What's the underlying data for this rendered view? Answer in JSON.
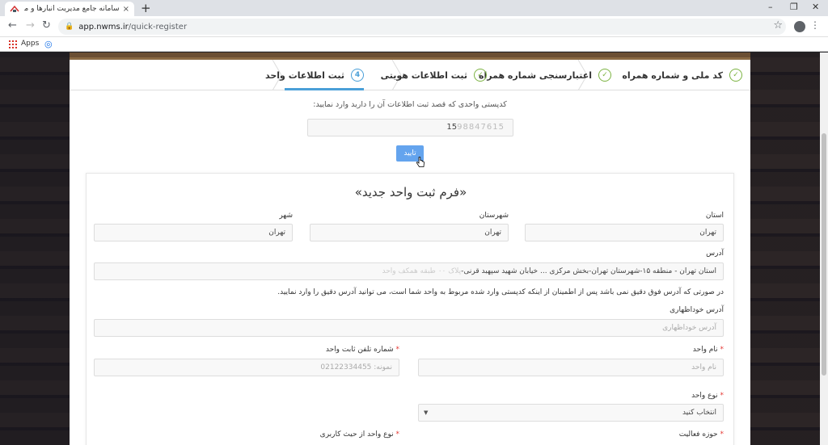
{
  "browser": {
    "tab_title": "سامانه جامع مدیریت انبارها و مراک",
    "tab_close": "×",
    "new_tab": "+",
    "url_domain": "app.nwms.ir",
    "url_path": "/quick-register",
    "bookmarks_apps": "Apps",
    "window_controls": [
      "–",
      "❐",
      "✕"
    ]
  },
  "steps": [
    {
      "label": "کد ملی و شماره همراه",
      "state": "done"
    },
    {
      "label": "اعتبارسنجی شماره همراه",
      "state": "done"
    },
    {
      "label": "ثبت اطلاعات هویتی",
      "state": "done"
    },
    {
      "label": "ثبت اطلاعات واحد",
      "state": "active",
      "number": "4"
    }
  ],
  "lookup": {
    "prompt": "کدپستی واحدی که قصد ثبت اطلاعات آن را دارید وارد نمایید:",
    "postal_code_prefix": "15",
    "postal_code_rest": "98847615",
    "confirm_label": "تایید"
  },
  "form": {
    "title": "«فرم ثبت واحد جدید»",
    "province_label": "استان",
    "province_value": "تهران",
    "county_label": "شهرستان",
    "county_value": "تهران",
    "city_label": "شهر",
    "city_value": "تهران",
    "address_label": "آدرس",
    "address_value": "استان تهران - منطقه ۱۵-شهرستان تهران-بخش مرکزی ... خیابان شهید سپهبد قرنی-",
    "address_blurred": "پلاک ۰۰ طبقه همکف واحد",
    "note": "در صورتی که آدرس فوق دقیق نمی باشد پس از اطمینان از اینکه کدپستی وارد شده مربوط به واحد شما است، می توانید آدرس دقیق را وارد نمایید.",
    "manual_address_label": "آدرس خوداظهاری",
    "manual_address_placeholder": "آدرس خوداظهاری",
    "unit_name_label": "نام واحد",
    "unit_name_placeholder": "نام واحد",
    "phone_label": "شماره تلفن ثابت واحد",
    "phone_placeholder": "نمونه: 02122334455",
    "unit_type_label": "نوع واحد",
    "unit_type_value": "انتخاب کنید",
    "activity_label": "حوزه فعالیت",
    "ownership_label": "نوع واحد از حیث کاربری",
    "required_mark": "*"
  },
  "colors": {
    "accent": "#4a9fd8",
    "done": "#7cb342",
    "button": "#64a4ee",
    "required": "#e53935"
  },
  "icons": {
    "step_done": "✓",
    "select_arrow": "▼"
  }
}
